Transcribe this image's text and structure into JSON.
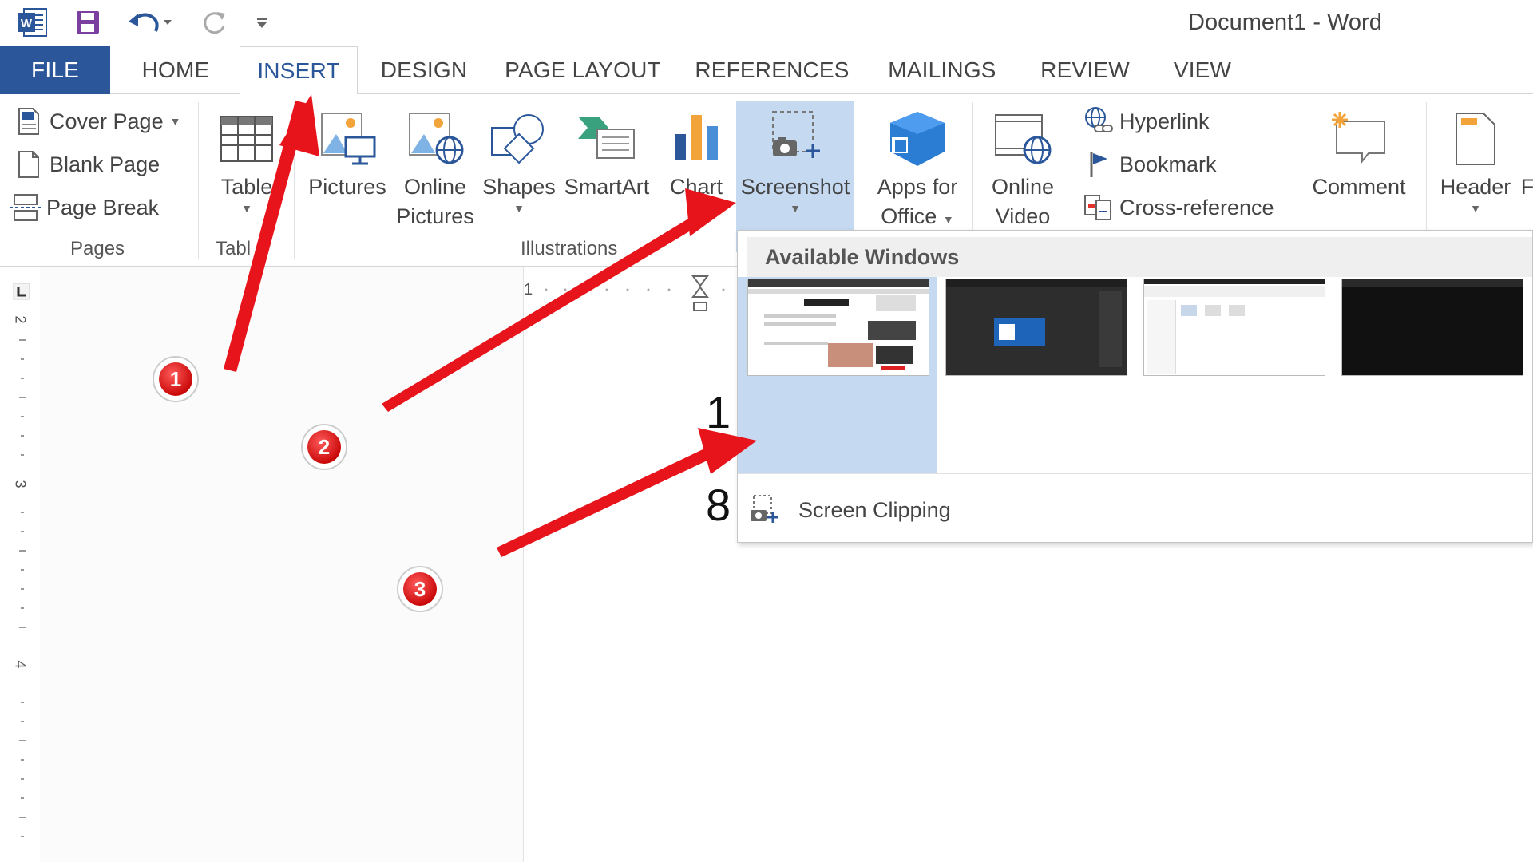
{
  "window": {
    "title": "Document1 - Word"
  },
  "quick_access": {
    "word_logo": "word-logo",
    "save": "save-icon",
    "undo": "undo-icon",
    "redo": "redo-icon",
    "customize": "customize-qat-icon"
  },
  "tabs": [
    {
      "label": "FILE"
    },
    {
      "label": "HOME"
    },
    {
      "label": "INSERT"
    },
    {
      "label": "DESIGN"
    },
    {
      "label": "PAGE LAYOUT"
    },
    {
      "label": "REFERENCES"
    },
    {
      "label": "MAILINGS"
    },
    {
      "label": "REVIEW"
    },
    {
      "label": "VIEW"
    }
  ],
  "active_tab": "INSERT",
  "ribbon": {
    "pages": {
      "group_label": "Pages",
      "cover_page": "Cover Page",
      "blank_page": "Blank Page",
      "page_break": "Page Break"
    },
    "tables": {
      "group_label": "Tabl",
      "table": "Table"
    },
    "illustrations": {
      "group_label": "Illustrations",
      "pictures": "Pictures",
      "online_pictures_1": "Online",
      "online_pictures_2": "Pictures",
      "shapes": "Shapes",
      "smartart": "SmartArt",
      "chart": "Chart",
      "screenshot": "Screenshot"
    },
    "apps": {
      "line1": "Apps for",
      "line2": "Office"
    },
    "media": {
      "line1": "Online",
      "line2": "Video"
    },
    "links": {
      "hyperlink": "Hyperlink",
      "bookmark": "Bookmark",
      "cross_reference": "Cross-reference"
    },
    "comments": {
      "comment": "Comment"
    },
    "header_footer": {
      "header": "Header",
      "partial": "F"
    }
  },
  "document": {
    "hruler_number": "1",
    "vruler_numbers": [
      "2",
      "3",
      "4"
    ],
    "text_1": "1",
    "text_2": "8"
  },
  "screenshot_menu": {
    "header": "Available Windows",
    "screen_clipping": "Screen Clipping"
  },
  "annotations": [
    {
      "label": "1"
    },
    {
      "label": "2"
    },
    {
      "label": "3"
    }
  ],
  "colors": {
    "accent": "#2b579a",
    "selected": "#c5d9f1",
    "arrow": "#e8141b"
  }
}
